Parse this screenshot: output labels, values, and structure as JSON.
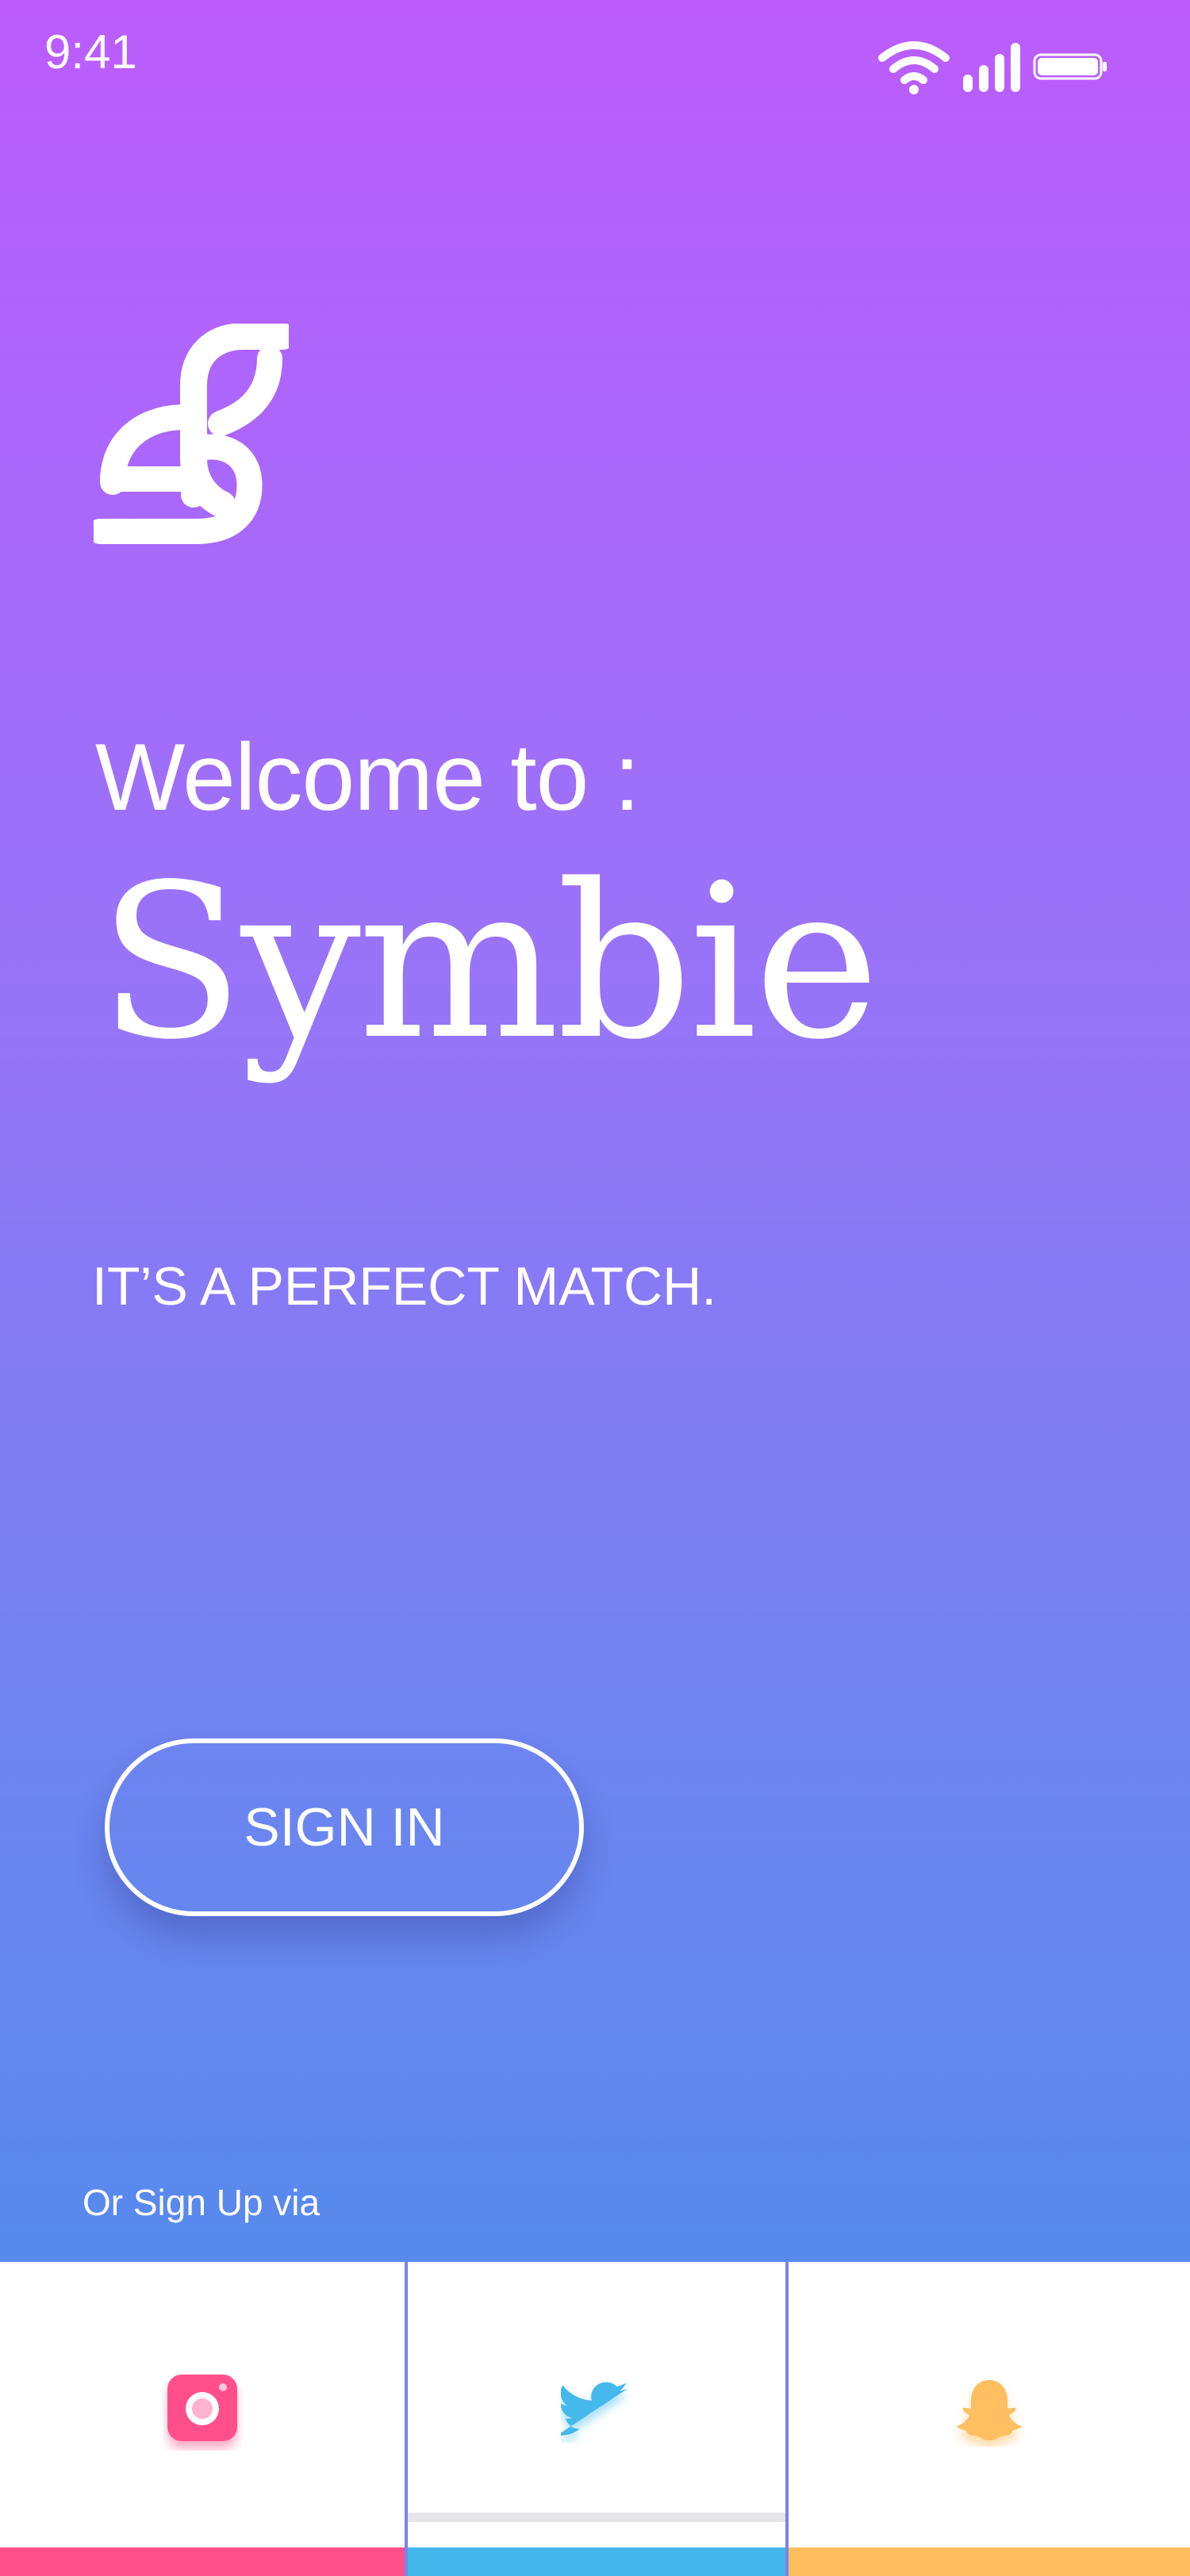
{
  "status_bar": {
    "time": "9:41",
    "icons": [
      "wifi-icon",
      "signal-icon",
      "battery-icon"
    ]
  },
  "logo": {
    "icon": "symbie-logo-icon"
  },
  "welcome": {
    "line1": "Welcome to :",
    "brand": "Symbie",
    "tagline": "IT’S A PERFECT MATCH."
  },
  "signin_button": {
    "label": "SIGN IN"
  },
  "signup": {
    "label": "Or Sign Up via",
    "providers": [
      {
        "name": "instagram",
        "icon": "instagram-icon",
        "color": "#FF4F8B"
      },
      {
        "name": "twitter",
        "icon": "twitter-icon",
        "color": "#44B8EC"
      },
      {
        "name": "snapchat",
        "icon": "snapchat-icon",
        "color": "#FFBE5E"
      }
    ]
  },
  "colors": {
    "gradient_top": "#BC5CFD",
    "gradient_bottom": "#4A8DEB",
    "divider": "#7C82EC"
  }
}
